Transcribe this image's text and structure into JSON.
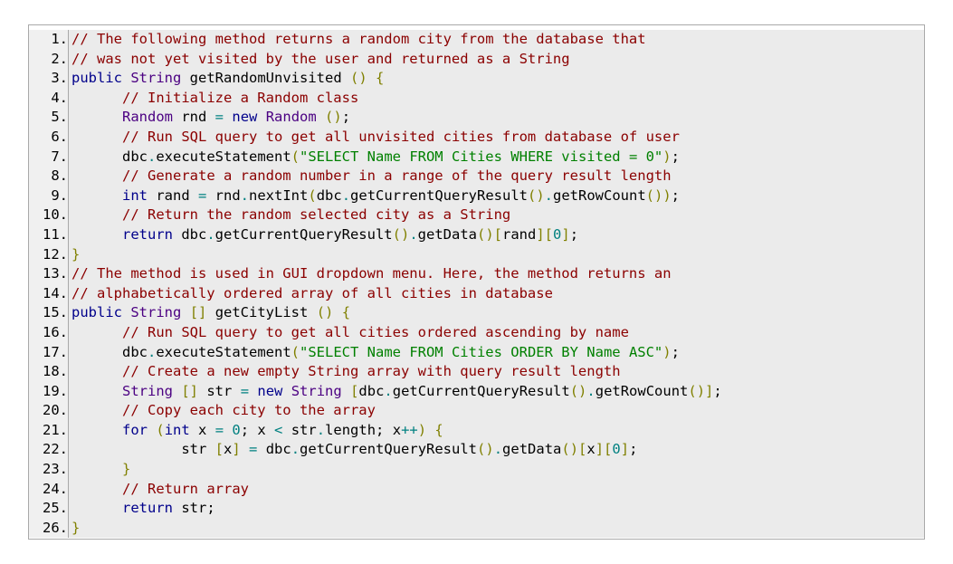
{
  "code": {
    "lines": [
      {
        "number": "1.",
        "indent": "",
        "tokens": [
          {
            "t": "// The following method returns a random city from the database that",
            "c": "comment"
          }
        ]
      },
      {
        "number": "2.",
        "indent": "",
        "tokens": [
          {
            "t": "// was not yet visited by the user and returned as a String",
            "c": "comment"
          }
        ]
      },
      {
        "number": "3.",
        "indent": "",
        "tokens": [
          {
            "t": "public",
            "c": "keyword"
          },
          {
            "t": " ",
            "c": "plain"
          },
          {
            "t": "String",
            "c": "type"
          },
          {
            "t": " getRandomUnvisited ",
            "c": "plain"
          },
          {
            "t": "()",
            "c": "punct"
          },
          {
            "t": " ",
            "c": "plain"
          },
          {
            "t": "{",
            "c": "punct"
          }
        ]
      },
      {
        "number": "4.",
        "indent": "      ",
        "tokens": [
          {
            "t": "// Initialize a Random class",
            "c": "comment"
          }
        ]
      },
      {
        "number": "5.",
        "indent": "      ",
        "tokens": [
          {
            "t": "Random",
            "c": "type"
          },
          {
            "t": " rnd ",
            "c": "plain"
          },
          {
            "t": "=",
            "c": "op"
          },
          {
            "t": " ",
            "c": "plain"
          },
          {
            "t": "new",
            "c": "keyword"
          },
          {
            "t": " ",
            "c": "plain"
          },
          {
            "t": "Random",
            "c": "type"
          },
          {
            "t": " ",
            "c": "plain"
          },
          {
            "t": "()",
            "c": "punct"
          },
          {
            "t": ";",
            "c": "plain"
          }
        ]
      },
      {
        "number": "6.",
        "indent": "      ",
        "tokens": [
          {
            "t": "// Run SQL query to get all unvisited cities from database of user",
            "c": "comment"
          }
        ]
      },
      {
        "number": "7.",
        "indent": "      ",
        "tokens": [
          {
            "t": "dbc",
            "c": "plain"
          },
          {
            "t": ".",
            "c": "op"
          },
          {
            "t": "executeStatement",
            "c": "plain"
          },
          {
            "t": "(",
            "c": "punct"
          },
          {
            "t": "\"SELECT Name FROM Cities WHERE visited = 0\"",
            "c": "string"
          },
          {
            "t": ")",
            "c": "punct"
          },
          {
            "t": ";",
            "c": "plain"
          }
        ]
      },
      {
        "number": "8.",
        "indent": "      ",
        "tokens": [
          {
            "t": "// Generate a random number in a range of the query result length",
            "c": "comment"
          }
        ]
      },
      {
        "number": "9.",
        "indent": "      ",
        "tokens": [
          {
            "t": "int",
            "c": "keyword"
          },
          {
            "t": " rand ",
            "c": "plain"
          },
          {
            "t": "=",
            "c": "op"
          },
          {
            "t": " rnd",
            "c": "plain"
          },
          {
            "t": ".",
            "c": "op"
          },
          {
            "t": "nextInt",
            "c": "plain"
          },
          {
            "t": "(",
            "c": "punct"
          },
          {
            "t": "dbc",
            "c": "plain"
          },
          {
            "t": ".",
            "c": "op"
          },
          {
            "t": "getCurrentQueryResult",
            "c": "plain"
          },
          {
            "t": "()",
            "c": "punct"
          },
          {
            "t": ".",
            "c": "op"
          },
          {
            "t": "getRowCount",
            "c": "plain"
          },
          {
            "t": "())",
            "c": "punct"
          },
          {
            "t": ";",
            "c": "plain"
          }
        ]
      },
      {
        "number": "10.",
        "indent": "      ",
        "tokens": [
          {
            "t": "// Return the random selected city as a String",
            "c": "comment"
          }
        ]
      },
      {
        "number": "11.",
        "indent": "      ",
        "tokens": [
          {
            "t": "return",
            "c": "keyword"
          },
          {
            "t": " dbc",
            "c": "plain"
          },
          {
            "t": ".",
            "c": "op"
          },
          {
            "t": "getCurrentQueryResult",
            "c": "plain"
          },
          {
            "t": "()",
            "c": "punct"
          },
          {
            "t": ".",
            "c": "op"
          },
          {
            "t": "getData",
            "c": "plain"
          },
          {
            "t": "()",
            "c": "punct"
          },
          {
            "t": "[",
            "c": "punct"
          },
          {
            "t": "rand",
            "c": "plain"
          },
          {
            "t": "][",
            "c": "punct"
          },
          {
            "t": "0",
            "c": "number"
          },
          {
            "t": "]",
            "c": "punct"
          },
          {
            "t": ";",
            "c": "plain"
          }
        ]
      },
      {
        "number": "12.",
        "indent": "",
        "tokens": [
          {
            "t": "}",
            "c": "punct"
          }
        ]
      },
      {
        "number": "13.",
        "indent": "",
        "tokens": [
          {
            "t": "// The method is used in GUI dropdown menu. Here, the method returns an",
            "c": "comment"
          }
        ]
      },
      {
        "number": "14.",
        "indent": "",
        "tokens": [
          {
            "t": "// alphabetically ordered array of all cities in database",
            "c": "comment"
          }
        ]
      },
      {
        "number": "15.",
        "indent": "",
        "tokens": [
          {
            "t": "public",
            "c": "keyword"
          },
          {
            "t": " ",
            "c": "plain"
          },
          {
            "t": "String",
            "c": "type"
          },
          {
            "t": " ",
            "c": "plain"
          },
          {
            "t": "[]",
            "c": "punct"
          },
          {
            "t": " getCityList ",
            "c": "plain"
          },
          {
            "t": "()",
            "c": "punct"
          },
          {
            "t": " ",
            "c": "plain"
          },
          {
            "t": "{",
            "c": "punct"
          }
        ]
      },
      {
        "number": "16.",
        "indent": "      ",
        "tokens": [
          {
            "t": "// Run SQL query to get all cities ordered ascending by name",
            "c": "comment"
          }
        ]
      },
      {
        "number": "17.",
        "indent": "      ",
        "tokens": [
          {
            "t": "dbc",
            "c": "plain"
          },
          {
            "t": ".",
            "c": "op"
          },
          {
            "t": "executeStatement",
            "c": "plain"
          },
          {
            "t": "(",
            "c": "punct"
          },
          {
            "t": "\"SELECT Name FROM Cities ORDER BY Name ASC\"",
            "c": "string"
          },
          {
            "t": ")",
            "c": "punct"
          },
          {
            "t": ";",
            "c": "plain"
          }
        ]
      },
      {
        "number": "18.",
        "indent": "      ",
        "tokens": [
          {
            "t": "// Create a new empty String array with query result length",
            "c": "comment"
          }
        ]
      },
      {
        "number": "19.",
        "indent": "      ",
        "tokens": [
          {
            "t": "String",
            "c": "type"
          },
          {
            "t": " ",
            "c": "plain"
          },
          {
            "t": "[]",
            "c": "punct"
          },
          {
            "t": " str ",
            "c": "plain"
          },
          {
            "t": "=",
            "c": "op"
          },
          {
            "t": " ",
            "c": "plain"
          },
          {
            "t": "new",
            "c": "keyword"
          },
          {
            "t": " ",
            "c": "plain"
          },
          {
            "t": "String",
            "c": "type"
          },
          {
            "t": " ",
            "c": "plain"
          },
          {
            "t": "[",
            "c": "punct"
          },
          {
            "t": "dbc",
            "c": "plain"
          },
          {
            "t": ".",
            "c": "op"
          },
          {
            "t": "getCurrentQueryResult",
            "c": "plain"
          },
          {
            "t": "()",
            "c": "punct"
          },
          {
            "t": ".",
            "c": "op"
          },
          {
            "t": "getRowCount",
            "c": "plain"
          },
          {
            "t": "()]",
            "c": "punct"
          },
          {
            "t": ";",
            "c": "plain"
          }
        ]
      },
      {
        "number": "20.",
        "indent": "      ",
        "tokens": [
          {
            "t": "// Copy each city to the array",
            "c": "comment"
          }
        ]
      },
      {
        "number": "21.",
        "indent": "      ",
        "tokens": [
          {
            "t": "for",
            "c": "keyword"
          },
          {
            "t": " ",
            "c": "plain"
          },
          {
            "t": "(",
            "c": "punct"
          },
          {
            "t": "int",
            "c": "keyword"
          },
          {
            "t": " x ",
            "c": "plain"
          },
          {
            "t": "=",
            "c": "op"
          },
          {
            "t": " ",
            "c": "plain"
          },
          {
            "t": "0",
            "c": "number"
          },
          {
            "t": "; x ",
            "c": "plain"
          },
          {
            "t": "<",
            "c": "op"
          },
          {
            "t": " str",
            "c": "plain"
          },
          {
            "t": ".",
            "c": "op"
          },
          {
            "t": "length; x",
            "c": "plain"
          },
          {
            "t": "++",
            "c": "op"
          },
          {
            "t": ")",
            "c": "punct"
          },
          {
            "t": " ",
            "c": "plain"
          },
          {
            "t": "{",
            "c": "punct"
          }
        ]
      },
      {
        "number": "22.",
        "indent": "             ",
        "tokens": [
          {
            "t": "str ",
            "c": "plain"
          },
          {
            "t": "[",
            "c": "punct"
          },
          {
            "t": "x",
            "c": "plain"
          },
          {
            "t": "]",
            "c": "punct"
          },
          {
            "t": " ",
            "c": "plain"
          },
          {
            "t": "=",
            "c": "op"
          },
          {
            "t": " dbc",
            "c": "plain"
          },
          {
            "t": ".",
            "c": "op"
          },
          {
            "t": "getCurrentQueryResult",
            "c": "plain"
          },
          {
            "t": "()",
            "c": "punct"
          },
          {
            "t": ".",
            "c": "op"
          },
          {
            "t": "getData",
            "c": "plain"
          },
          {
            "t": "()",
            "c": "punct"
          },
          {
            "t": "[",
            "c": "punct"
          },
          {
            "t": "x",
            "c": "plain"
          },
          {
            "t": "][",
            "c": "punct"
          },
          {
            "t": "0",
            "c": "number"
          },
          {
            "t": "]",
            "c": "punct"
          },
          {
            "t": ";",
            "c": "plain"
          }
        ]
      },
      {
        "number": "23.",
        "indent": "      ",
        "tokens": [
          {
            "t": "}",
            "c": "punct"
          }
        ]
      },
      {
        "number": "24.",
        "indent": "      ",
        "tokens": [
          {
            "t": "// Return array",
            "c": "comment"
          }
        ]
      },
      {
        "number": "25.",
        "indent": "      ",
        "tokens": [
          {
            "t": "return",
            "c": "keyword"
          },
          {
            "t": " str;",
            "c": "plain"
          }
        ]
      },
      {
        "number": "26.",
        "indent": "",
        "tokens": [
          {
            "t": "}",
            "c": "punct"
          }
        ]
      }
    ]
  }
}
